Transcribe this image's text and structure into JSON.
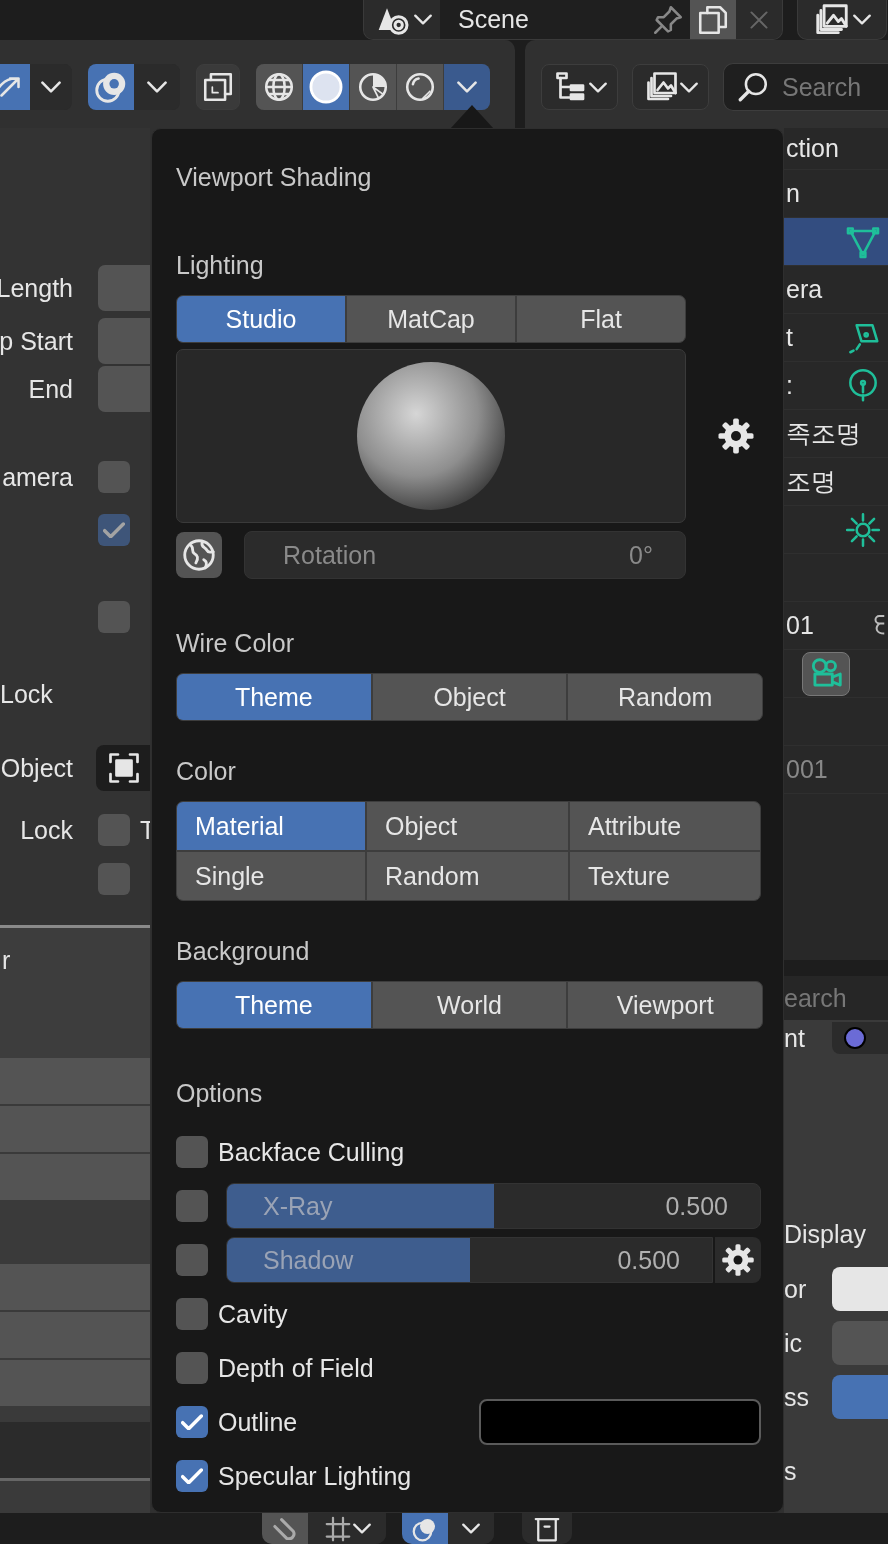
{
  "header": {
    "scene": "Scene"
  },
  "viewport_header": {
    "shading_modes": [
      {
        "selected": false
      },
      {
        "selected": true
      },
      {
        "selected": false
      },
      {
        "selected": false
      }
    ]
  },
  "outliner_header": {
    "search_placeholder": "Search"
  },
  "properties": {
    "rows": [
      {
        "kind": "field",
        "label": "Length"
      },
      {
        "kind": "field",
        "label": "p Start"
      },
      {
        "kind": "field",
        "label": "End"
      },
      {
        "kind": "checkbox",
        "label": "amera",
        "checked": false,
        "disabled": false
      },
      {
        "kind": "checkbox",
        "checked": true,
        "disabled": true
      },
      {
        "kind": "checkbox",
        "checked": false,
        "disabled": false
      },
      {
        "kind": "heading",
        "label": "Lock"
      },
      {
        "kind": "object",
        "label": "Object"
      },
      {
        "kind": "checkbox",
        "label": "Lock",
        "text": "T",
        "checked": false,
        "disabled": false
      },
      {
        "kind": "checkbox",
        "checked": false,
        "disabled": false
      },
      {
        "kind": "section",
        "label": "r"
      }
    ]
  },
  "shading_popover": {
    "title": "Viewport Shading",
    "lighting": {
      "label": "Lighting",
      "modes": [
        {
          "label": "Studio",
          "selected": true
        },
        {
          "label": "MatCap",
          "selected": false
        },
        {
          "label": "Flat",
          "selected": false
        }
      ],
      "rotation_label": "Rotation",
      "rotation_value": "0°"
    },
    "wire_color": {
      "label": "Wire Color",
      "options": [
        {
          "label": "Theme",
          "selected": true
        },
        {
          "label": "Object",
          "selected": false
        },
        {
          "label": "Random",
          "selected": false
        }
      ]
    },
    "color": {
      "label": "Color",
      "options": [
        {
          "label": "Material",
          "selected": true
        },
        {
          "label": "Object",
          "selected": false
        },
        {
          "label": "Attribute",
          "selected": false
        },
        {
          "label": "Single",
          "selected": false
        },
        {
          "label": "Random",
          "selected": false
        },
        {
          "label": "Texture",
          "selected": false
        }
      ]
    },
    "background": {
      "label": "Background",
      "options": [
        {
          "label": "Theme",
          "selected": true
        },
        {
          "label": "World",
          "selected": false
        },
        {
          "label": "Viewport",
          "selected": false
        }
      ]
    },
    "options": {
      "label": "Options",
      "items": [
        {
          "kind": "checkbox",
          "label": "Backface Culling",
          "checked": false
        },
        {
          "kind": "slider",
          "label": "X-Ray",
          "checked": false,
          "level": 0.5,
          "value": "0.500",
          "settings": false
        },
        {
          "kind": "slider",
          "label": "Shadow",
          "checked": false,
          "level": 0.5,
          "value": "0.500",
          "settings": true
        },
        {
          "kind": "checkbox",
          "label": "Cavity",
          "checked": false
        },
        {
          "kind": "checkbox",
          "label": "Depth of Field",
          "checked": false
        },
        {
          "kind": "color",
          "label": "Outline",
          "checked": true,
          "color": "#000000"
        },
        {
          "kind": "checkbox",
          "label": "Specular Lighting",
          "checked": true
        }
      ]
    }
  },
  "outliner": {
    "rows": [
      {
        "kind": "item",
        "label": "ction",
        "selected": false
      },
      {
        "kind": "item",
        "label": "n",
        "selected": false
      },
      {
        "kind": "item",
        "selected": true
      },
      {
        "kind": "item",
        "label": "era",
        "selected": false
      },
      {
        "kind": "item",
        "label": "t",
        "selected": false
      },
      {
        "kind": "item",
        "label": ":",
        "selected": false
      },
      {
        "kind": "item",
        "label": "족조명",
        "selected": false
      },
      {
        "kind": "item",
        "label": "조명",
        "selected": false
      },
      {
        "kind": "item",
        "selected": false
      },
      {
        "kind": "item",
        "selected": false
      },
      {
        "kind": "item",
        "label": "01",
        "selected": false
      },
      {
        "kind": "item",
        "selected": false
      },
      {
        "kind": "item",
        "selected": false
      },
      {
        "kind": "inactive",
        "label": "001",
        "selected": false
      }
    ]
  },
  "material_panel": {
    "search_placeholder": "earch",
    "rows": [
      {
        "kind": "slot",
        "label": "nt",
        "color": "#6b6bd6"
      },
      {
        "kind": "heading",
        "label": "Display"
      },
      {
        "kind": "swatch",
        "label": "or",
        "color": "#e6e6e6"
      },
      {
        "kind": "swatch",
        "label": "ic",
        "color": "#545454"
      },
      {
        "kind": "swatch",
        "label": "ss",
        "color": "#4772b3"
      },
      {
        "kind": "text",
        "label": "s"
      }
    ]
  }
}
